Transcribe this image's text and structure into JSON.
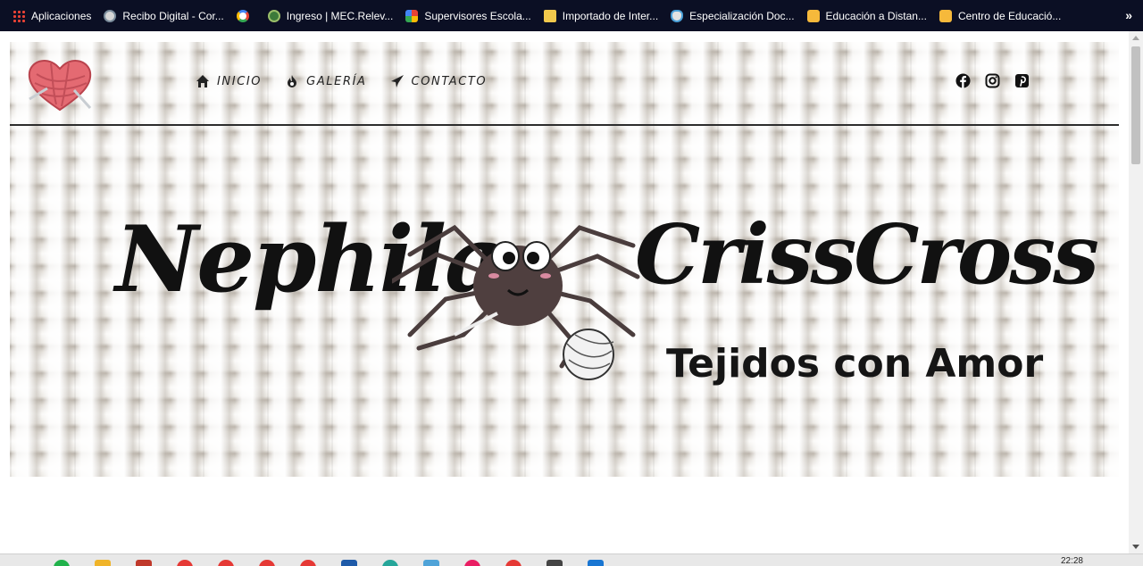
{
  "bookmarks": [
    {
      "label": "Aplicaciones",
      "icon": "apps-grid-icon"
    },
    {
      "label": "Recibo Digital - Cor...",
      "icon": "shield-icon"
    },
    {
      "label": "",
      "icon": "google-icon"
    },
    {
      "label": "Ingreso | MEC.Relev...",
      "icon": "seal-icon"
    },
    {
      "label": "Supervisores Escola...",
      "icon": "pinwheel-icon"
    },
    {
      "label": "Importado de Inter...",
      "icon": "folder-icon"
    },
    {
      "label": "Especialización Doc...",
      "icon": "pin-icon"
    },
    {
      "label": "Educación a Distan...",
      "icon": "ordinal-icon"
    },
    {
      "label": "Centro de Educació...",
      "icon": "ordinal-icon"
    }
  ],
  "overflow": "»",
  "nav": {
    "items": [
      {
        "label": "INICIO",
        "icon": "home-icon"
      },
      {
        "label": "GALERÍA",
        "icon": "fire-icon"
      },
      {
        "label": "CONTACTO",
        "icon": "paper-plane-icon"
      }
    ]
  },
  "social": [
    "facebook-icon",
    "instagram-icon",
    "pinterest-icon"
  ],
  "brand": {
    "name_left": "Nephila",
    "name_right": "CrissCross",
    "tagline": "Tejidos con Amor"
  },
  "taskbar": {
    "clock": "22:28"
  }
}
